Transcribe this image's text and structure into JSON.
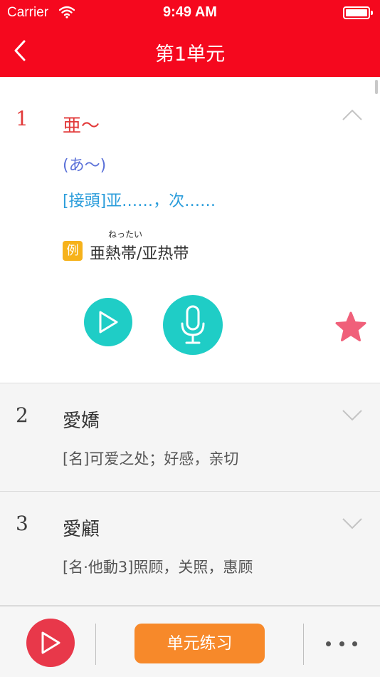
{
  "status_bar": {
    "carrier": "Carrier",
    "time": "9:49 AM"
  },
  "nav": {
    "title": "第1单元"
  },
  "entries": [
    {
      "number": "1",
      "word": "亜～",
      "reading": "(あ～)",
      "meaning": "[接頭]亚……，次……",
      "example": {
        "badge": "例",
        "furigana": "ねったい",
        "text": "亜熱帯/亚热带"
      }
    },
    {
      "number": "2",
      "word": "愛嬌",
      "meaning": "[名]可爱之处；好感，亲切"
    },
    {
      "number": "3",
      "word": "愛顧",
      "meaning": "[名·他動3]照顾，关照，惠顾"
    }
  ],
  "bottom_bar": {
    "practice_label": "单元练习"
  },
  "colors": {
    "header": "#f5081e",
    "accent_teal": "#1fcdc6",
    "star_pink": "#f0607a",
    "practice_orange": "#f7892a",
    "play_red": "#e8384a"
  },
  "icons": [
    "back-chevron-icon",
    "wifi-icon",
    "battery-icon",
    "chevron-up-icon",
    "chevron-down-icon",
    "play-icon",
    "microphone-icon",
    "star-icon",
    "more-dots-icon"
  ]
}
